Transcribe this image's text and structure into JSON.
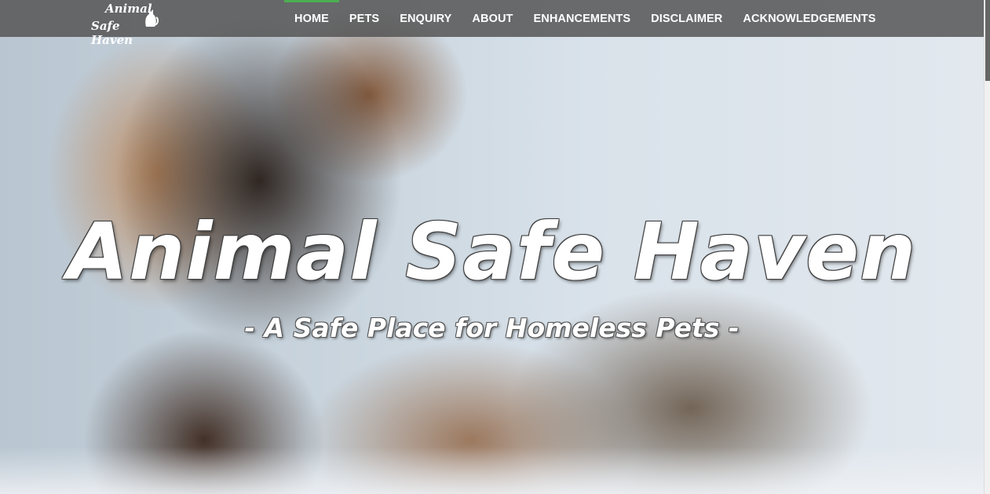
{
  "logo": {
    "line1": "Animal",
    "line2": "Safe Haven",
    "icon": "cat-icon"
  },
  "nav": {
    "items": [
      {
        "label": "HOME",
        "active": true
      },
      {
        "label": "PETS",
        "active": false
      },
      {
        "label": "ENQUIRY",
        "active": false
      },
      {
        "label": "ABOUT",
        "active": false
      },
      {
        "label": "ENHANCEMENTS",
        "active": false
      },
      {
        "label": "DISCLAIMER",
        "active": false
      },
      {
        "label": "ACKNOWLEDGEMENTS",
        "active": false
      }
    ]
  },
  "hero": {
    "title": "Animal Safe Haven",
    "subtitle": "- A Safe Place for Homeless Pets -",
    "background": "dog-and-cat-photo"
  },
  "colors": {
    "active_indicator": "#4caf50",
    "navbar_bg": "#555555"
  }
}
